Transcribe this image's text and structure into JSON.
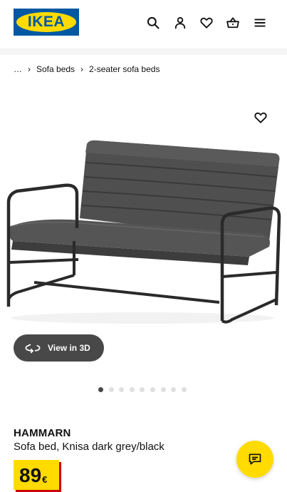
{
  "header": {
    "logo_text": "IKEA",
    "icons": [
      "search-icon",
      "user-icon",
      "heart-icon",
      "basket-icon",
      "menu-icon"
    ]
  },
  "breadcrumb": {
    "ellipsis": "…",
    "items": [
      "Sofa beds",
      "2-seater sofa beds"
    ]
  },
  "gallery": {
    "view3d_label": "View in 3D",
    "dot_count": 9,
    "active_dot": 0
  },
  "product": {
    "name": "HAMMARN",
    "description": "Sofa bed, Knisa dark grey/black",
    "price_value": "89",
    "price_currency": "€"
  },
  "colors": {
    "ikea_blue": "#0058a3",
    "ikea_yellow": "#ffdb00",
    "price_shadow": "#cc0008",
    "pill_grey": "#484848"
  }
}
